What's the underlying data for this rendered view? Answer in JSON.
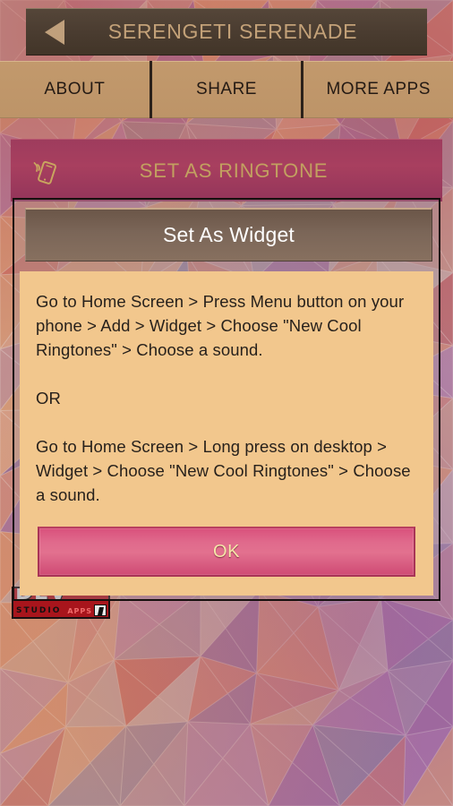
{
  "header": {
    "title": "SERENGETI SERENADE",
    "back_icon": "back-triangle-icon"
  },
  "tabs": [
    {
      "label": "ABOUT"
    },
    {
      "label": "SHARE"
    },
    {
      "label": "MORE APPS"
    }
  ],
  "ringtone_button": {
    "label": "SET AS RINGTONE",
    "icon": "ringtone-phone-icon"
  },
  "studio_banner": {
    "brand": "DEV",
    "sub": "STUDIO",
    "tag": "APPS"
  },
  "dialog": {
    "title": "Set As Widget",
    "paragraph_1": "Go to Home Screen > Press Menu button on your phone > Add > Widget > Choose \"New Cool Ringtones\" > Choose a sound.",
    "paragraph_2": "OR",
    "paragraph_3": "Go to Home Screen > Long press on desktop > Widget > Choose \"New Cool Ringtones\" > Choose a sound.",
    "ok_label": "OK"
  },
  "colors": {
    "header_bar": "#4a3c30",
    "header_text": "#c3a178",
    "tab_bg": "#bd9468",
    "tab_text": "#241a14",
    "ringtone_bg": "#a83f5f",
    "ringtone_text": "#c2a060",
    "dialog_title_bg": "#7b6658",
    "dialog_title_text": "#ffffff",
    "dialog_body_bg": "#f2c78d",
    "dialog_body_text": "#27211c",
    "ok_button_bg": "#e0688b",
    "ok_button_text": "#f5e6a8",
    "banner_red": "#a8151c"
  }
}
